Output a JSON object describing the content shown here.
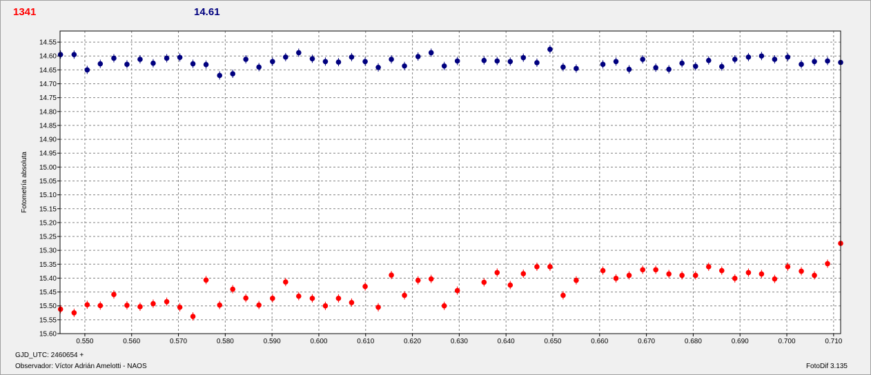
{
  "header": {
    "left_value": "1341",
    "right_value": "14.61"
  },
  "footer": {
    "gjd": "GJD_UTC: 2460654 +",
    "observer": "Observador: Víctor Adrián Amelotti - NAOS",
    "version": "FotoDif 3.135"
  },
  "colors": {
    "series_red": "#ff0000",
    "series_blue": "#00007f",
    "background": "#ffffff",
    "grid": "#808080"
  },
  "chart_data": {
    "type": "scatter",
    "title": "",
    "xlabel": "",
    "ylabel": "Fotometría absoluta",
    "xlim": [
      0.5447,
      0.7115
    ],
    "ylim": [
      14.51,
      15.6
    ],
    "y_inverted": true,
    "grid": true,
    "x_ticks": [
      "0.550",
      "0.560",
      "0.570",
      "0.580",
      "0.590",
      "0.600",
      "0.610",
      "0.620",
      "0.630",
      "0.640",
      "0.650",
      "0.660",
      "0.670",
      "0.680",
      "0.690",
      "0.700",
      "0.710"
    ],
    "y_ticks": [
      "14.55",
      "14.60",
      "14.65",
      "14.70",
      "14.75",
      "14.80",
      "14.85",
      "14.90",
      "14.95",
      "15.00",
      "15.05",
      "15.10",
      "15.15",
      "15.20",
      "15.25",
      "15.30",
      "15.35",
      "15.40",
      "15.45",
      "15.50",
      "15.55",
      "15.60"
    ],
    "series": [
      {
        "color": "#00007f",
        "x": [
          0.5448,
          0.5477,
          0.5505,
          0.5533,
          0.5562,
          0.559,
          0.5618,
          0.5646,
          0.5675,
          0.5703,
          0.5731,
          0.5759,
          0.5788,
          0.5816,
          0.5844,
          0.5872,
          0.5901,
          0.5929,
          0.5957,
          0.5986,
          0.6014,
          0.6042,
          0.607,
          0.6099,
          0.6127,
          0.6155,
          0.6183,
          0.6212,
          0.624,
          0.6268,
          0.6296,
          0.6353,
          0.6381,
          0.6409,
          0.6437,
          0.6466,
          0.6494,
          0.6522,
          0.655,
          0.6607,
          0.6635,
          0.6663,
          0.6692,
          0.672,
          0.6748,
          0.6776,
          0.6805,
          0.6833,
          0.6861,
          0.6889,
          0.6918,
          0.6946,
          0.6974,
          0.7002,
          0.7031,
          0.7059,
          0.7087,
          0.7115
        ],
        "y": [
          14.595,
          14.595,
          14.65,
          14.628,
          14.608,
          14.63,
          14.612,
          14.626,
          14.608,
          14.605,
          14.628,
          14.631,
          14.67,
          14.664,
          14.612,
          14.64,
          14.62,
          14.604,
          14.588,
          14.61,
          14.62,
          14.622,
          14.604,
          14.62,
          14.641,
          14.612,
          14.636,
          14.602,
          14.588,
          14.636,
          14.618,
          14.616,
          14.618,
          14.62,
          14.606,
          14.624,
          14.576,
          14.64,
          14.645,
          14.63,
          14.62,
          14.648,
          14.612,
          14.642,
          14.648,
          14.626,
          14.637,
          14.616,
          14.638,
          14.612,
          14.604,
          14.6,
          14.612,
          14.604,
          14.63,
          14.62,
          14.618,
          14.623
        ]
      },
      {
        "color": "#ff0000",
        "x": [
          0.5448,
          0.5477,
          0.5505,
          0.5533,
          0.5562,
          0.559,
          0.5618,
          0.5646,
          0.5675,
          0.5703,
          0.5731,
          0.5759,
          0.5788,
          0.5816,
          0.5844,
          0.5872,
          0.5901,
          0.5929,
          0.5957,
          0.5986,
          0.6014,
          0.6042,
          0.607,
          0.6099,
          0.6127,
          0.6155,
          0.6183,
          0.6212,
          0.624,
          0.6268,
          0.6296,
          0.6353,
          0.6381,
          0.6409,
          0.6437,
          0.6466,
          0.6494,
          0.6522,
          0.655,
          0.6607,
          0.6635,
          0.6663,
          0.6692,
          0.672,
          0.6748,
          0.6776,
          0.6805,
          0.6833,
          0.6861,
          0.6889,
          0.6918,
          0.6946,
          0.6974,
          0.7002,
          0.7031,
          0.7059,
          0.7087,
          0.7115
        ],
        "y": [
          15.512,
          15.525,
          15.496,
          15.499,
          15.459,
          15.498,
          15.503,
          15.492,
          15.485,
          15.505,
          15.538,
          15.407,
          15.497,
          15.44,
          15.472,
          15.497,
          15.473,
          15.414,
          15.465,
          15.473,
          15.5,
          15.473,
          15.488,
          15.43,
          15.505,
          15.389,
          15.462,
          15.408,
          15.403,
          15.5,
          15.445,
          15.415,
          15.38,
          15.425,
          15.384,
          15.359,
          15.359,
          15.462,
          15.408,
          15.373,
          15.401,
          15.39,
          15.37,
          15.37,
          15.385,
          15.39,
          15.39,
          15.359,
          15.373,
          15.401,
          15.38,
          15.385,
          15.403,
          15.359,
          15.375,
          15.39,
          15.348,
          15.275
        ]
      }
    ]
  }
}
